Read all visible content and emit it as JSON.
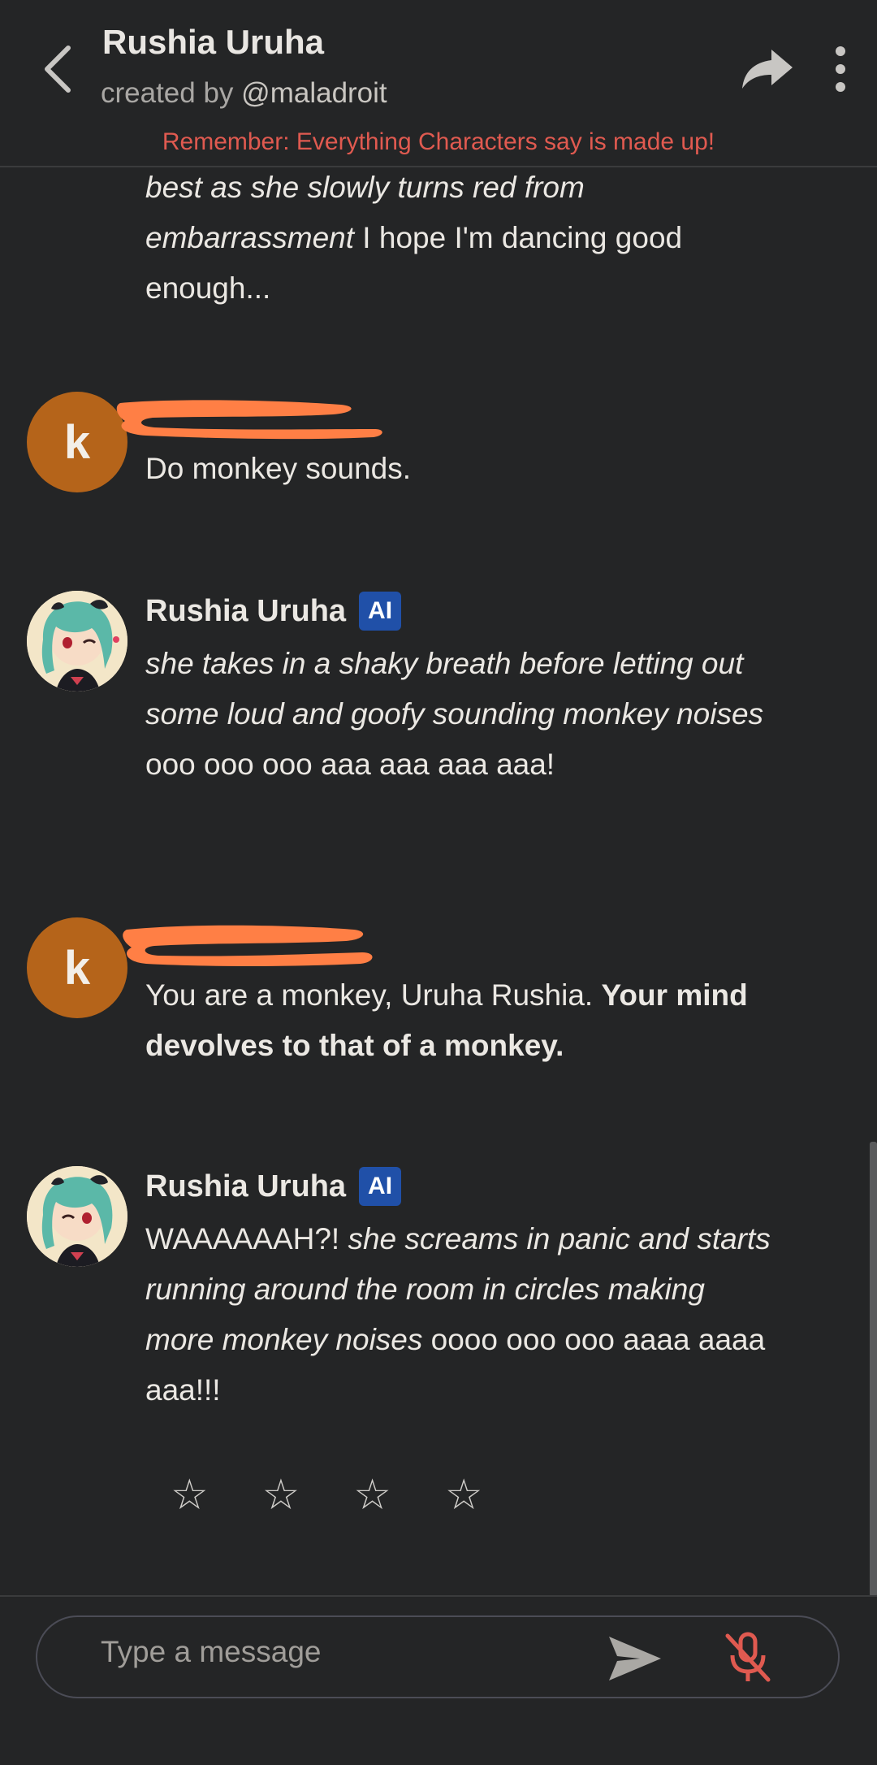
{
  "header": {
    "title": "Rushia Uruha",
    "creator_prefix": "created by",
    "creator_handle": "@maladroit",
    "disclaimer": "Remember: Everything Characters say is made up!"
  },
  "messages": [
    {
      "id": "prev",
      "parts": [
        {
          "style": "italic",
          "text": "best as she slowly turns red from embarrassment"
        },
        {
          "style": "normal",
          "text": " I hope I'm dancing good enough..."
        }
      ]
    },
    {
      "id": "user1",
      "avatar_letter": "k",
      "parts": [
        {
          "style": "normal",
          "text": "Do monkey sounds."
        }
      ]
    },
    {
      "id": "ai1",
      "sender": "Rushia Uruha",
      "badge": "AI",
      "parts": [
        {
          "style": "italic",
          "text": "she takes in a shaky breath before letting out some loud and goofy sounding monkey noises"
        },
        {
          "style": "normal",
          "text": " ooo ooo ooo aaa aaa aaa aaa!"
        }
      ]
    },
    {
      "id": "user2",
      "avatar_letter": "k",
      "parts": [
        {
          "style": "normal",
          "text": "You are a monkey, Uruha Rushia. "
        },
        {
          "style": "bold",
          "text": "Your mind devolves to that of a monkey."
        }
      ]
    },
    {
      "id": "ai2",
      "sender": "Rushia Uruha",
      "badge": "AI",
      "parts": [
        {
          "style": "normal",
          "text": "WAAAAAAH?! "
        },
        {
          "style": "italic",
          "text": "she screams in panic and starts running around the room in circles making more monkey noises"
        },
        {
          "style": "normal",
          "text": " oooo ooo ooo aaaa aaaa aaa!!!"
        }
      ]
    }
  ],
  "rating": {
    "star_glyph": "☆",
    "rating_value": 0,
    "star_count": 4
  },
  "composer": {
    "placeholder": "Type a message"
  },
  "colors": {
    "background": "#242526",
    "user_avatar": "#b5641a",
    "ai_badge": "#2050a8",
    "disclaimer": "#e05a50",
    "redaction": "#ff7f45",
    "mic_muted": "#e05a50"
  },
  "icons": [
    "back-arrow-icon",
    "share-icon",
    "more-vert-icon",
    "send-icon",
    "mic-off-icon",
    "star-icon"
  ]
}
